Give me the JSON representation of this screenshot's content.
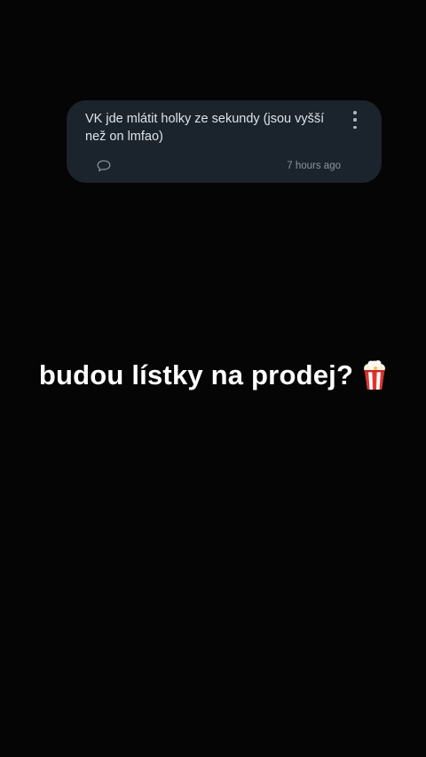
{
  "comment": {
    "text": "VK jde mlátit holky ze sekundy (jsou vyšší než on lmfao)",
    "timestamp": "7 hours ago",
    "icons": {
      "reply": "speech-bubble-icon",
      "menu": "more-vertical-icon"
    }
  },
  "caption": {
    "text": "budou lístky na prodej?",
    "emoji_icon": "popcorn-icon"
  },
  "colors": {
    "background": "#050505",
    "card": "#1b232c",
    "comment_text": "#dfe3e8",
    "meta_text": "#8b949d",
    "caption_text": "#ffffff"
  }
}
